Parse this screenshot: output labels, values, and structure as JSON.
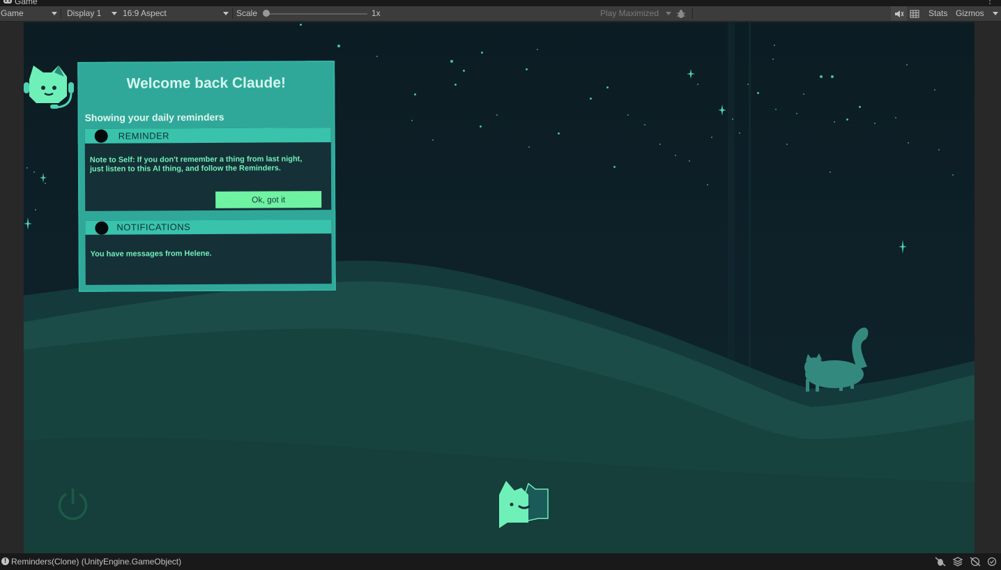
{
  "window": {
    "tab_title": "Game"
  },
  "toolbar": {
    "mode": "Game",
    "display": "Display 1",
    "aspect": "16:9 Aspect",
    "scale_label": "Scale",
    "scale_value": "1x",
    "play_mode": "Play Maximized",
    "stats_label": "Stats",
    "gizmos_label": "Gizmos"
  },
  "game": {
    "welcome_title": "Welcome back Claude!",
    "subtitle": "Showing your daily reminders",
    "reminder": {
      "header": "REMINDER",
      "text": "Note to Self: If you don't remember a thing from last night, just listen to this AI thing, and follow the Reminders.",
      "button": "Ok, got it"
    },
    "notifications": {
      "header": "NOTIFICATIONS",
      "text": "You have messages from Helene."
    },
    "colors": {
      "accent": "#2fa89a",
      "header_bar": "#39c3ac",
      "text_green": "#6ff0b8",
      "button_green": "#6ff2a2",
      "sky": "#0c1c23",
      "hills": "#17433f"
    }
  },
  "status": {
    "message": "Reminders(Clone) (UnityEngine.GameObject)"
  }
}
